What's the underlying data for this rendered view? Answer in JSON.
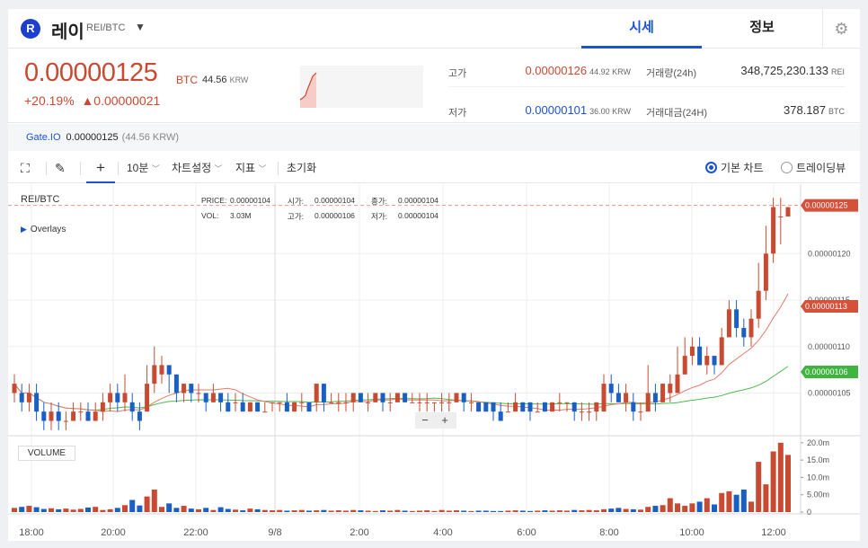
{
  "header": {
    "logo_letter": "R",
    "coin_name": "레이",
    "pair": "REI/BTC",
    "tabs": [
      "시세",
      "정보"
    ],
    "settings_icon": "gear-icon"
  },
  "price": {
    "current": "0.00000125",
    "unit": "BTC",
    "krw": "44.56",
    "krw_unit": "KRW",
    "change_pct": "+20.19%",
    "change_abs": "▲0.00000021"
  },
  "stats": {
    "high_label": "고가",
    "high_value": "0.00000126",
    "high_krw": "44.92 KRW",
    "low_label": "저가",
    "low_value": "0.00000101",
    "low_krw": "36.00 KRW",
    "volume_label": "거래량(24h)",
    "volume_value": "348,725,230.133",
    "volume_unit": "REI",
    "amount_label": "거래대금(24H)",
    "amount_value": "378.187",
    "amount_unit": "BTC"
  },
  "exchange": {
    "name": "Gate.IO",
    "price": "0.00000125",
    "krw": "(44.56 KRW)"
  },
  "toolbar": {
    "interval": "10분",
    "chart_settings": "차트설정",
    "indicators": "지표",
    "reset": "초기화",
    "basic_chart": "기본 차트",
    "tradingview": "트레이딩뷰"
  },
  "chart": {
    "symbol": "REI/BTC",
    "overlays": "Overlays",
    "legend": {
      "price_label": "PRICE:",
      "price": "0.00000104",
      "vol_label": "VOL:",
      "vol": "3.03M",
      "open_label": "시가:",
      "open": "0.00000104",
      "close_label": "종가:",
      "close": "0.00000104",
      "high_label": "고가:",
      "high": "0.00000106",
      "low_label": "저가:",
      "low": "0.00000104"
    },
    "volume_label": "VOLUME",
    "price_ticks": [
      "0.00000120",
      "0.00000115",
      "0.00000110",
      "0.00000105"
    ],
    "vol_ticks": [
      "20.0m",
      "15.0m",
      "10.0m",
      "5.00m",
      "0"
    ],
    "time_ticks": [
      "18:00",
      "20:00",
      "22:00",
      "9/8",
      "2:00",
      "4:00",
      "6:00",
      "8:00",
      "10:00",
      "12:00"
    ],
    "tag_last": "0.00000125",
    "tag_ma_red": "0.00000113",
    "tag_ma_green": "0.00000106",
    "colors": {
      "up": "#c84a31",
      "down": "#1a5fc4",
      "ma_short": "#e37a6a",
      "ma_long": "#4cbb4c"
    }
  },
  "chart_data": {
    "type": "candlestick",
    "price_axis": [
      1.01e-06,
      1.27e-06
    ],
    "candles": [
      [
        1.05,
        1.06,
        1.07,
        1.04
      ],
      [
        1.05,
        1.04,
        1.06,
        1.03
      ],
      [
        1.04,
        1.05,
        1.06,
        1.03
      ],
      [
        1.05,
        1.03,
        1.06,
        1.02
      ],
      [
        1.03,
        1.02,
        1.04,
        1.01
      ],
      [
        1.02,
        1.03,
        1.04,
        1.01
      ],
      [
        1.03,
        1.02,
        1.04,
        1.01
      ],
      [
        1.02,
        1.02,
        1.03,
        1.01
      ],
      [
        1.02,
        1.03,
        1.04,
        1.02
      ],
      [
        1.03,
        1.03,
        1.04,
        1.02
      ],
      [
        1.03,
        1.02,
        1.04,
        1.02
      ],
      [
        1.02,
        1.03,
        1.04,
        1.02
      ],
      [
        1.03,
        1.04,
        1.05,
        1.02
      ],
      [
        1.04,
        1.05,
        1.06,
        1.03
      ],
      [
        1.05,
        1.04,
        1.06,
        1.03
      ],
      [
        1.04,
        1.05,
        1.07,
        1.03
      ],
      [
        1.04,
        1.03,
        1.05,
        1.02
      ],
      [
        1.03,
        1.02,
        1.04,
        1.01
      ],
      [
        1.03,
        1.06,
        1.08,
        1.03
      ],
      [
        1.06,
        1.08,
        1.1,
        1.05
      ],
      [
        1.07,
        1.08,
        1.09,
        1.06
      ],
      [
        1.08,
        1.07,
        1.08,
        1.05
      ],
      [
        1.07,
        1.05,
        1.07,
        1.04
      ],
      [
        1.05,
        1.06,
        1.06,
        1.04
      ],
      [
        1.06,
        1.05,
        1.06,
        1.04
      ],
      [
        1.05,
        1.05,
        1.06,
        1.04
      ],
      [
        1.05,
        1.04,
        1.05,
        1.03
      ],
      [
        1.04,
        1.05,
        1.06,
        1.04
      ],
      [
        1.05,
        1.04,
        1.05,
        1.03
      ],
      [
        1.04,
        1.03,
        1.05,
        1.03
      ],
      [
        1.04,
        1.04,
        1.05,
        1.03
      ],
      [
        1.04,
        1.03,
        1.05,
        1.03
      ],
      [
        1.03,
        1.04,
        1.04,
        1.03
      ],
      [
        1.04,
        1.03,
        1.04,
        1.03
      ],
      [
        1.03,
        1.03,
        1.04,
        1.03
      ],
      [
        1.04,
        1.04,
        1.04,
        1.03
      ],
      [
        1.04,
        1.04,
        1.04,
        1.03
      ],
      [
        1.04,
        1.03,
        1.05,
        1.03
      ],
      [
        1.03,
        1.04,
        1.04,
        1.03
      ],
      [
        1.04,
        1.04,
        1.05,
        1.03
      ],
      [
        1.04,
        1.03,
        1.04,
        1.03
      ],
      [
        1.04,
        1.06,
        1.06,
        1.03
      ],
      [
        1.06,
        1.04,
        1.06,
        1.03
      ],
      [
        1.04,
        1.04,
        1.05,
        1.04
      ],
      [
        1.04,
        1.04,
        1.05,
        1.03
      ],
      [
        1.04,
        1.04,
        1.05,
        1.03
      ],
      [
        1.04,
        1.05,
        1.05,
        1.03
      ],
      [
        1.05,
        1.04,
        1.05,
        1.04
      ],
      [
        1.04,
        1.04,
        1.05,
        1.03
      ],
      [
        1.04,
        1.05,
        1.05,
        1.04
      ],
      [
        1.05,
        1.04,
        1.05,
        1.03
      ],
      [
        1.04,
        1.04,
        1.05,
        1.03
      ],
      [
        1.04,
        1.05,
        1.05,
        1.04
      ],
      [
        1.05,
        1.04,
        1.05,
        1.04
      ],
      [
        1.04,
        1.04,
        1.05,
        1.04
      ],
      [
        1.04,
        1.04,
        1.05,
        1.03
      ],
      [
        1.04,
        1.04,
        1.05,
        1.03
      ],
      [
        1.04,
        1.04,
        1.04,
        1.03
      ],
      [
        1.04,
        1.04,
        1.05,
        1.03
      ],
      [
        1.04,
        1.04,
        1.05,
        1.03
      ],
      [
        1.04,
        1.05,
        1.05,
        1.04
      ],
      [
        1.05,
        1.04,
        1.05,
        1.03
      ],
      [
        1.04,
        1.04,
        1.05,
        1.03
      ],
      [
        1.04,
        1.03,
        1.04,
        1.03
      ],
      [
        1.04,
        1.03,
        1.04,
        1.03
      ],
      [
        1.04,
        1.03,
        1.04,
        1.02
      ],
      [
        1.03,
        1.02,
        1.04,
        1.02
      ],
      [
        1.03,
        1.03,
        1.04,
        1.03
      ],
      [
        1.03,
        1.04,
        1.05,
        1.03
      ],
      [
        1.04,
        1.03,
        1.04,
        1.03
      ],
      [
        1.04,
        1.03,
        1.04,
        1.02
      ],
      [
        1.03,
        1.03,
        1.04,
        1.03
      ],
      [
        1.04,
        1.03,
        1.04,
        1.03
      ],
      [
        1.03,
        1.04,
        1.04,
        1.03
      ],
      [
        1.04,
        1.04,
        1.05,
        1.03
      ],
      [
        1.04,
        1.04,
        1.04,
        1.03
      ],
      [
        1.04,
        1.03,
        1.04,
        1.02
      ],
      [
        1.03,
        1.03,
        1.04,
        1.02
      ],
      [
        1.03,
        1.03,
        1.04,
        1.02
      ],
      [
        1.03,
        1.04,
        1.04,
        1.02
      ],
      [
        1.03,
        1.06,
        1.07,
        1.03
      ],
      [
        1.06,
        1.05,
        1.07,
        1.04
      ],
      [
        1.05,
        1.04,
        1.06,
        1.04
      ],
      [
        1.04,
        1.05,
        1.06,
        1.03
      ],
      [
        1.04,
        1.03,
        1.05,
        1.02
      ],
      [
        1.03,
        1.03,
        1.04,
        1.02
      ],
      [
        1.03,
        1.05,
        1.08,
        1.03
      ],
      [
        1.05,
        1.04,
        1.06,
        1.03
      ],
      [
        1.04,
        1.06,
        1.06,
        1.04
      ],
      [
        1.05,
        1.06,
        1.07,
        1.04
      ],
      [
        1.05,
        1.07,
        1.1,
        1.05
      ],
      [
        1.07,
        1.09,
        1.11,
        1.07
      ],
      [
        1.09,
        1.1,
        1.11,
        1.08
      ],
      [
        1.1,
        1.08,
        1.11,
        1.08
      ],
      [
        1.08,
        1.09,
        1.1,
        1.07
      ],
      [
        1.09,
        1.08,
        1.09,
        1.07
      ],
      [
        1.08,
        1.11,
        1.12,
        1.08
      ],
      [
        1.11,
        1.14,
        1.15,
        1.11
      ],
      [
        1.14,
        1.12,
        1.15,
        1.11
      ],
      [
        1.12,
        1.11,
        1.13,
        1.1
      ],
      [
        1.11,
        1.13,
        1.14,
        1.1
      ],
      [
        1.13,
        1.16,
        1.19,
        1.12
      ],
      [
        1.16,
        1.2,
        1.23,
        1.15
      ],
      [
        1.2,
        1.25,
        1.26,
        1.19
      ],
      [
        1.24,
        1.24,
        1.26,
        1.21
      ],
      [
        1.24,
        1.25,
        1.25,
        1.24
      ]
    ],
    "volumes": [
      1.2,
      1.5,
      1.8,
      1.4,
      0.9,
      1.1,
      0.8,
      1.0,
      0.7,
      0.9,
      1.3,
      1.5,
      0.6,
      0.8,
      1.2,
      2.0,
      3.5,
      1.9,
      4.5,
      6.5,
      1.5,
      2.5,
      1.2,
      1.8,
      1.0,
      0.8,
      1.2,
      0.6,
      1.4,
      0.9,
      0.7,
      0.5,
      1.0,
      0.8,
      0.6,
      0.5,
      0.6,
      0.4,
      0.5,
      0.6,
      0.4,
      0.5,
      0.6,
      0.4,
      0.5,
      0.4,
      0.6,
      0.5,
      0.4,
      0.3,
      0.5,
      0.4,
      0.6,
      0.4,
      0.3,
      0.4,
      0.5,
      0.3,
      0.6,
      0.4,
      0.5,
      0.4,
      0.3,
      0.4,
      0.4,
      0.3,
      0.3,
      0.4,
      0.5,
      0.4,
      0.3,
      0.4,
      0.5,
      0.4,
      0.5,
      0.4,
      0.6,
      0.5,
      0.6,
      0.5,
      0.8,
      1.0,
      1.2,
      0.9,
      0.8,
      0.7,
      1.5,
      1.8,
      2.0,
      4.0,
      2.5,
      1.8,
      2.5,
      3.0,
      4.0,
      2.2,
      5.5,
      6.0,
      5.0,
      6.5,
      3.0,
      14.5,
      8.0,
      17.5,
      20.0,
      16.5
    ]
  }
}
